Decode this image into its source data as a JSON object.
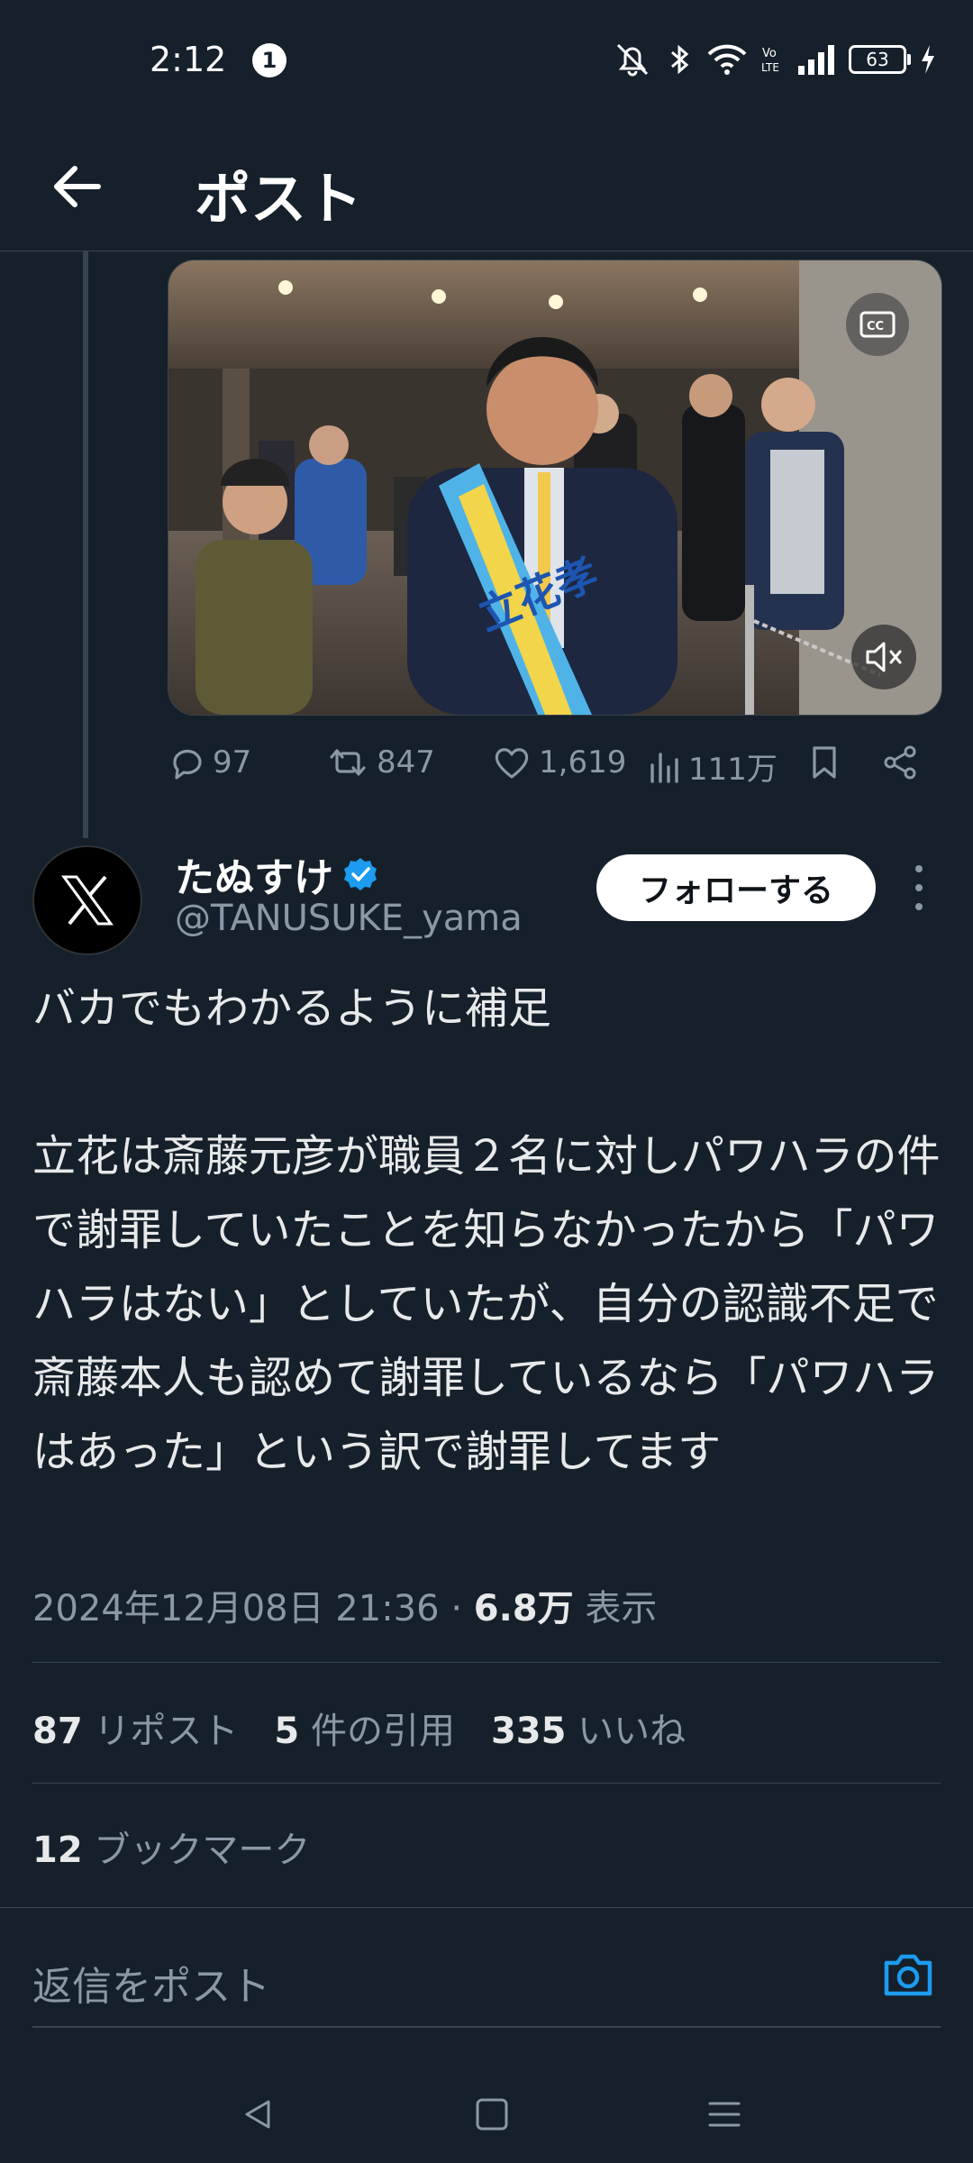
{
  "status_bar": {
    "time": "2:12",
    "notification_count": "1",
    "battery": "63"
  },
  "header": {
    "title": "ポスト"
  },
  "parent_post": {
    "video": {
      "cc_label": "CC",
      "sash_text": "立花孝"
    },
    "actions": {
      "replies": "97",
      "reposts": "847",
      "likes": "1,619",
      "views": "111万"
    }
  },
  "post": {
    "author": {
      "name": "たぬすけ",
      "handle": "@TANUSUKE_yama",
      "verified": true
    },
    "follow_label": "フォローする",
    "text": "バカでもわかるように補足\n\n立花は斎藤元彦が職員２名に対しパワハラの件で謝罪していたことを知らなかったから「パワハラはない」としていたが、自分の認識不足で斎藤本人も認めて謝罪しているなら「パワハラはあった」という訳で謝罪してます",
    "timestamp": "2024年12月08日 21:36",
    "separator": "·",
    "views_count": "6.8万",
    "views_label": "表示",
    "stats": {
      "reposts_count": "87",
      "reposts_label": "リポスト",
      "quotes_count": "5",
      "quotes_label": "件の引用",
      "likes_count": "335",
      "likes_label": "いいね",
      "bookmarks_count": "12",
      "bookmarks_label": "ブックマーク"
    }
  },
  "reply_box": {
    "placeholder": "返信をポスト"
  },
  "colors": {
    "background": "#15202b",
    "accent": "#1d9bf0",
    "muted_text": "#8b98a5",
    "divider": "#38444d"
  }
}
